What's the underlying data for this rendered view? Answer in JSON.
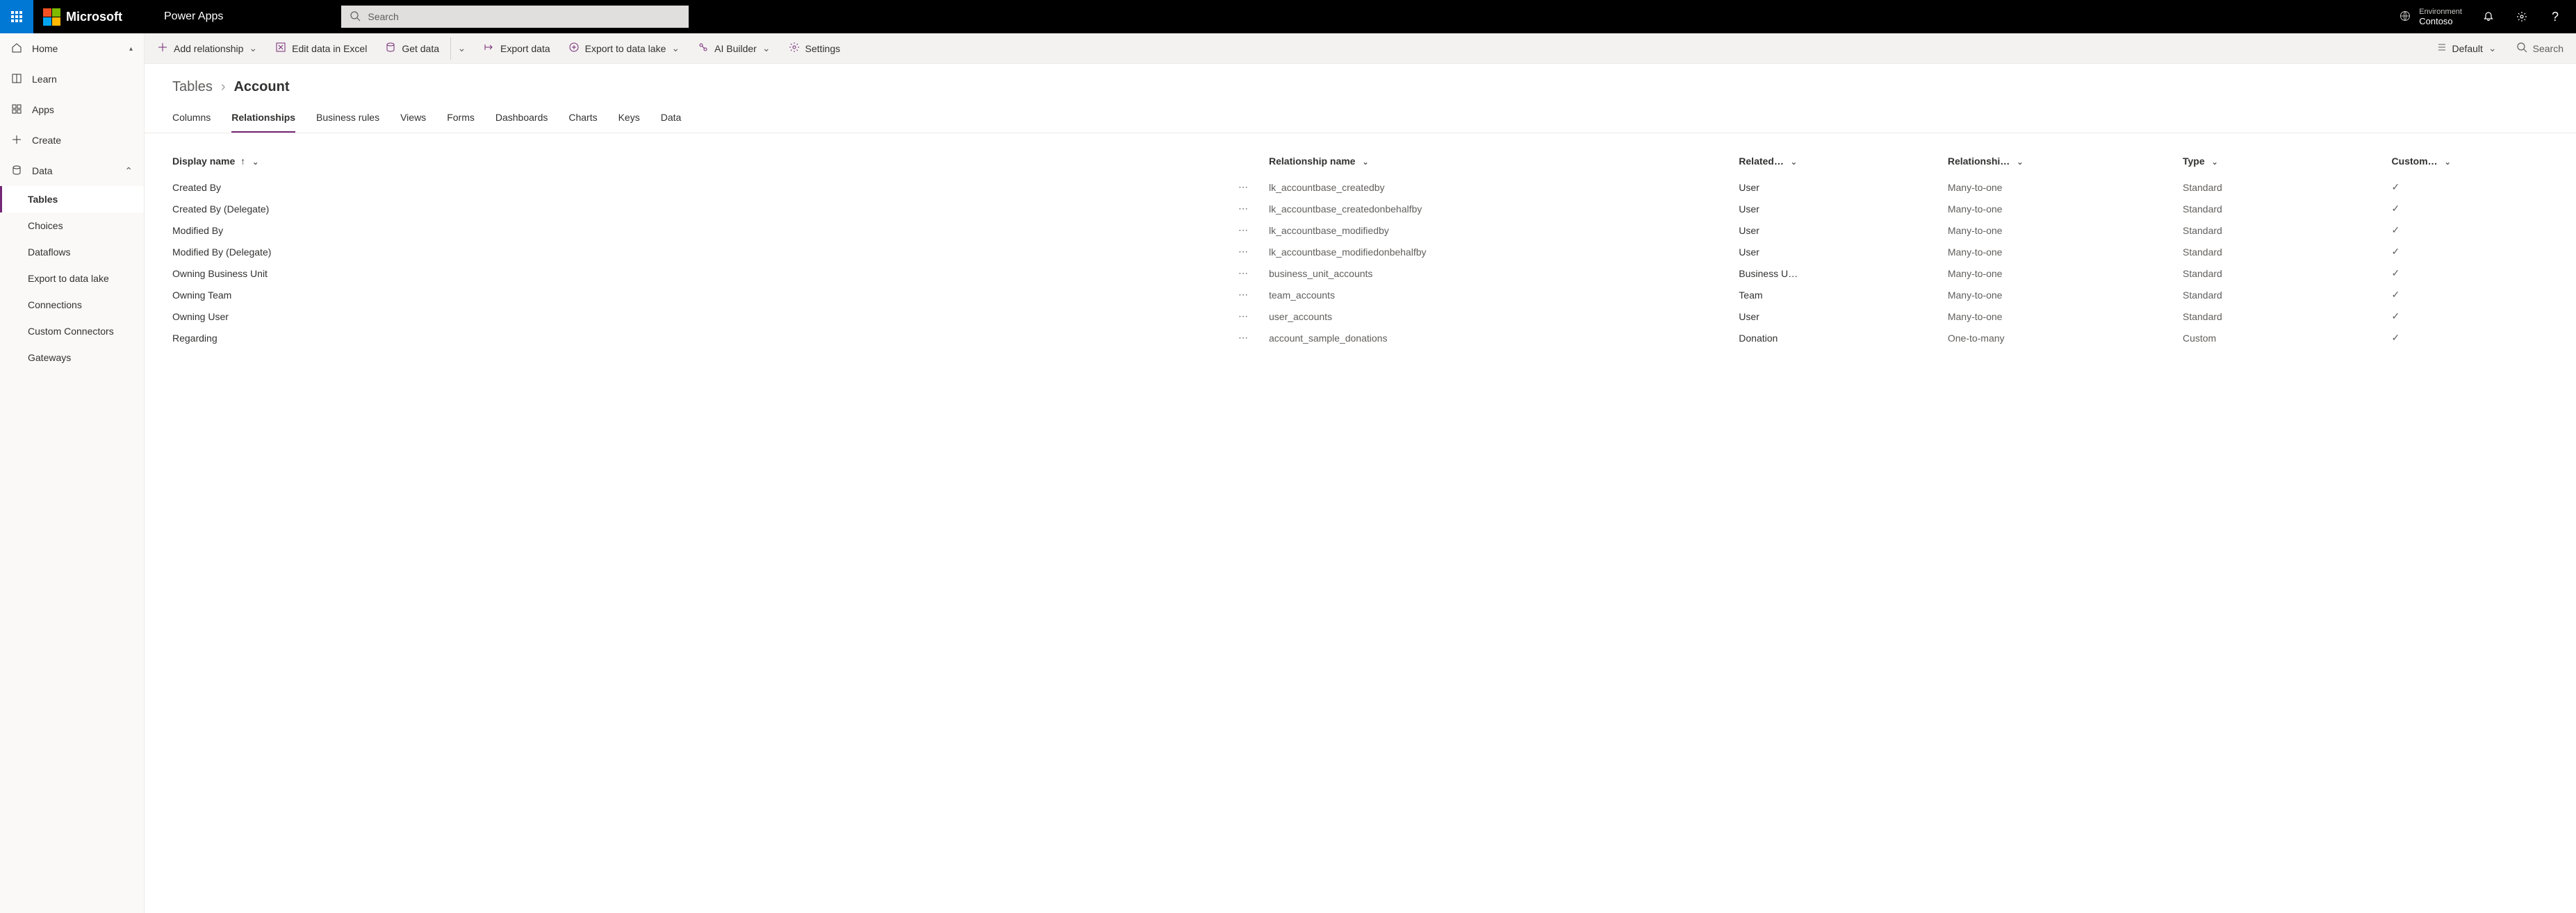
{
  "header": {
    "brand": "Microsoft",
    "app": "Power Apps",
    "search_placeholder": "Search",
    "env_label": "Environment",
    "env_name": "Contoso"
  },
  "sidenav": {
    "items": [
      {
        "label": "Home",
        "icon": "home"
      },
      {
        "label": "Learn",
        "icon": "book"
      },
      {
        "label": "Apps",
        "icon": "grid"
      },
      {
        "label": "Create",
        "icon": "plus"
      },
      {
        "label": "Data",
        "icon": "data",
        "expandable": true
      }
    ],
    "data_children": [
      {
        "label": "Tables",
        "active": true
      },
      {
        "label": "Choices"
      },
      {
        "label": "Dataflows"
      },
      {
        "label": "Export to data lake"
      },
      {
        "label": "Connections"
      },
      {
        "label": "Custom Connectors"
      },
      {
        "label": "Gateways"
      }
    ]
  },
  "cmdbar": {
    "add": "Add relationship",
    "edit": "Edit data in Excel",
    "get": "Get data",
    "export": "Export data",
    "lake": "Export to data lake",
    "ai": "AI Builder",
    "settings": "Settings",
    "view": "Default",
    "search": "Search"
  },
  "breadcrumb": {
    "root": "Tables",
    "current": "Account"
  },
  "tabs": [
    "Columns",
    "Relationships",
    "Business rules",
    "Views",
    "Forms",
    "Dashboards",
    "Charts",
    "Keys",
    "Data"
  ],
  "active_tab": "Relationships",
  "columns": {
    "display": "Display name",
    "relname": "Relationship name",
    "related": "Related…",
    "reltype": "Relationshi…",
    "type": "Type",
    "custom": "Custom…"
  },
  "rows": [
    {
      "display": "Created By",
      "rel": "lk_accountbase_createdby",
      "related": "User",
      "reltype": "Many-to-one",
      "type": "Standard",
      "custom": true
    },
    {
      "display": "Created By (Delegate)",
      "rel": "lk_accountbase_createdonbehalfby",
      "related": "User",
      "reltype": "Many-to-one",
      "type": "Standard",
      "custom": true
    },
    {
      "display": "Modified By",
      "rel": "lk_accountbase_modifiedby",
      "related": "User",
      "reltype": "Many-to-one",
      "type": "Standard",
      "custom": true
    },
    {
      "display": "Modified By (Delegate)",
      "rel": "lk_accountbase_modifiedonbehalfby",
      "related": "User",
      "reltype": "Many-to-one",
      "type": "Standard",
      "custom": true
    },
    {
      "display": "Owning Business Unit",
      "rel": "business_unit_accounts",
      "related": "Business U…",
      "reltype": "Many-to-one",
      "type": "Standard",
      "custom": true
    },
    {
      "display": "Owning Team",
      "rel": "team_accounts",
      "related": "Team",
      "reltype": "Many-to-one",
      "type": "Standard",
      "custom": true
    },
    {
      "display": "Owning User",
      "rel": "user_accounts",
      "related": "User",
      "reltype": "Many-to-one",
      "type": "Standard",
      "custom": true
    },
    {
      "display": "Regarding",
      "rel": "account_sample_donations",
      "related": "Donation",
      "reltype": "One-to-many",
      "type": "Custom",
      "custom": true
    }
  ]
}
